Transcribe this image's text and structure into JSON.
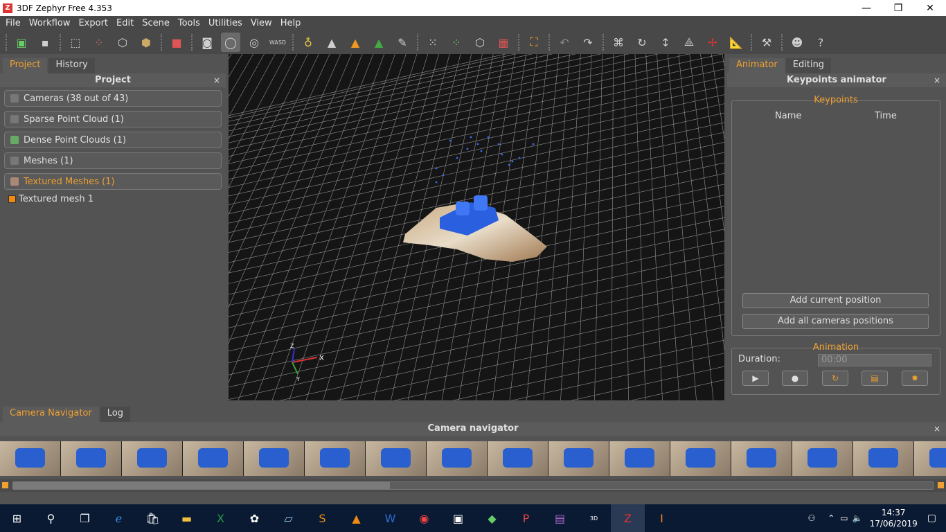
{
  "window": {
    "title": "3DF Zephyr Free 4.353",
    "app_icon": "Z"
  },
  "menu": [
    "File",
    "Workflow",
    "Export",
    "Edit",
    "Scene",
    "Tools",
    "Utilities",
    "View",
    "Help"
  ],
  "left_panel": {
    "tabs": [
      "Project",
      "History"
    ],
    "header": "Project",
    "close": "×",
    "items": [
      {
        "label": "Cameras (38 out of 43)",
        "active": false
      },
      {
        "label": "Sparse Point Cloud (1)",
        "active": false
      },
      {
        "label": "Dense Point Clouds (1)",
        "active": false
      },
      {
        "label": "Meshes (1)",
        "active": false
      },
      {
        "label": "Textured Meshes (1)",
        "active": true
      }
    ],
    "subitem": "Textured mesh 1"
  },
  "viewport": {
    "axis_x": "X",
    "axis_y": "Y",
    "axis_z": "Z"
  },
  "right_panel": {
    "tabs": [
      "Animator",
      "Editing"
    ],
    "header": "Keypoints animator",
    "close": "×",
    "keypoints_legend": "Keypoints",
    "col_name": "Name",
    "col_time": "Time",
    "add_current": "Add current position",
    "add_all": "Add all cameras positions",
    "animation_legend": "Animation",
    "duration_label": "Duration:",
    "duration_value": "00:00",
    "controls": [
      "▶",
      "●",
      "↻",
      "▤",
      "✹"
    ]
  },
  "bottom_panel": {
    "tabs": [
      "Camera Navigator",
      "Log"
    ],
    "header": "Camera navigator",
    "close": "×"
  },
  "taskbar": {
    "time": "14:37",
    "date": "17/06/2019"
  }
}
